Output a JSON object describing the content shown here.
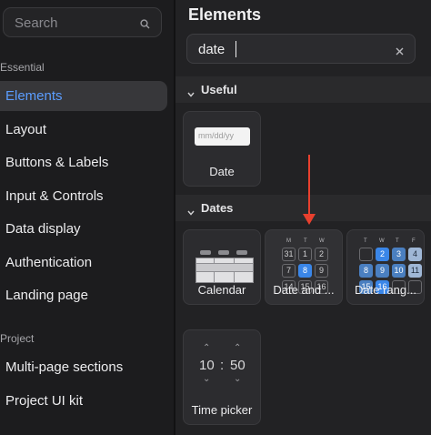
{
  "sidebar": {
    "search_placeholder": "Search",
    "section_essential": "Essential",
    "items": [
      {
        "label": "Elements"
      },
      {
        "label": "Layout"
      },
      {
        "label": "Buttons & Labels"
      },
      {
        "label": "Input & Controls"
      },
      {
        "label": "Data display"
      },
      {
        "label": "Authentication"
      },
      {
        "label": "Landing page"
      }
    ],
    "section_project": "Project",
    "project_items": [
      {
        "label": "Multi-page sections"
      },
      {
        "label": "Project UI kit"
      }
    ]
  },
  "main": {
    "title": "Elements",
    "filter_value": "date",
    "groups": [
      {
        "label": "Useful",
        "cards": [
          {
            "label": "Date",
            "preview_placeholder": "mm/dd/yy"
          }
        ]
      },
      {
        "label": "Dates",
        "cards": [
          {
            "label": "Calendar"
          },
          {
            "label": "Date and ...",
            "weekdays": [
              "M",
              "T",
              "W"
            ],
            "days": [
              "31",
              "1",
              "2",
              "7",
              "8",
              "9",
              "14",
              "15",
              "16"
            ],
            "selected": "8"
          },
          {
            "label": "Date rang...",
            "weekdays": [
              "T",
              "W",
              "T",
              "F"
            ],
            "days": [
              "2",
              "3",
              "4",
              "8",
              "9",
              "10",
              "11",
              "15",
              "16"
            ]
          },
          {
            "label": "Time picker",
            "hours": "10",
            "minutes": "50",
            "separator": ":"
          }
        ]
      }
    ]
  },
  "colors": {
    "accent": "#5b9dff",
    "selection_blue": "#3a86e8",
    "arrow": "#e8402e"
  }
}
